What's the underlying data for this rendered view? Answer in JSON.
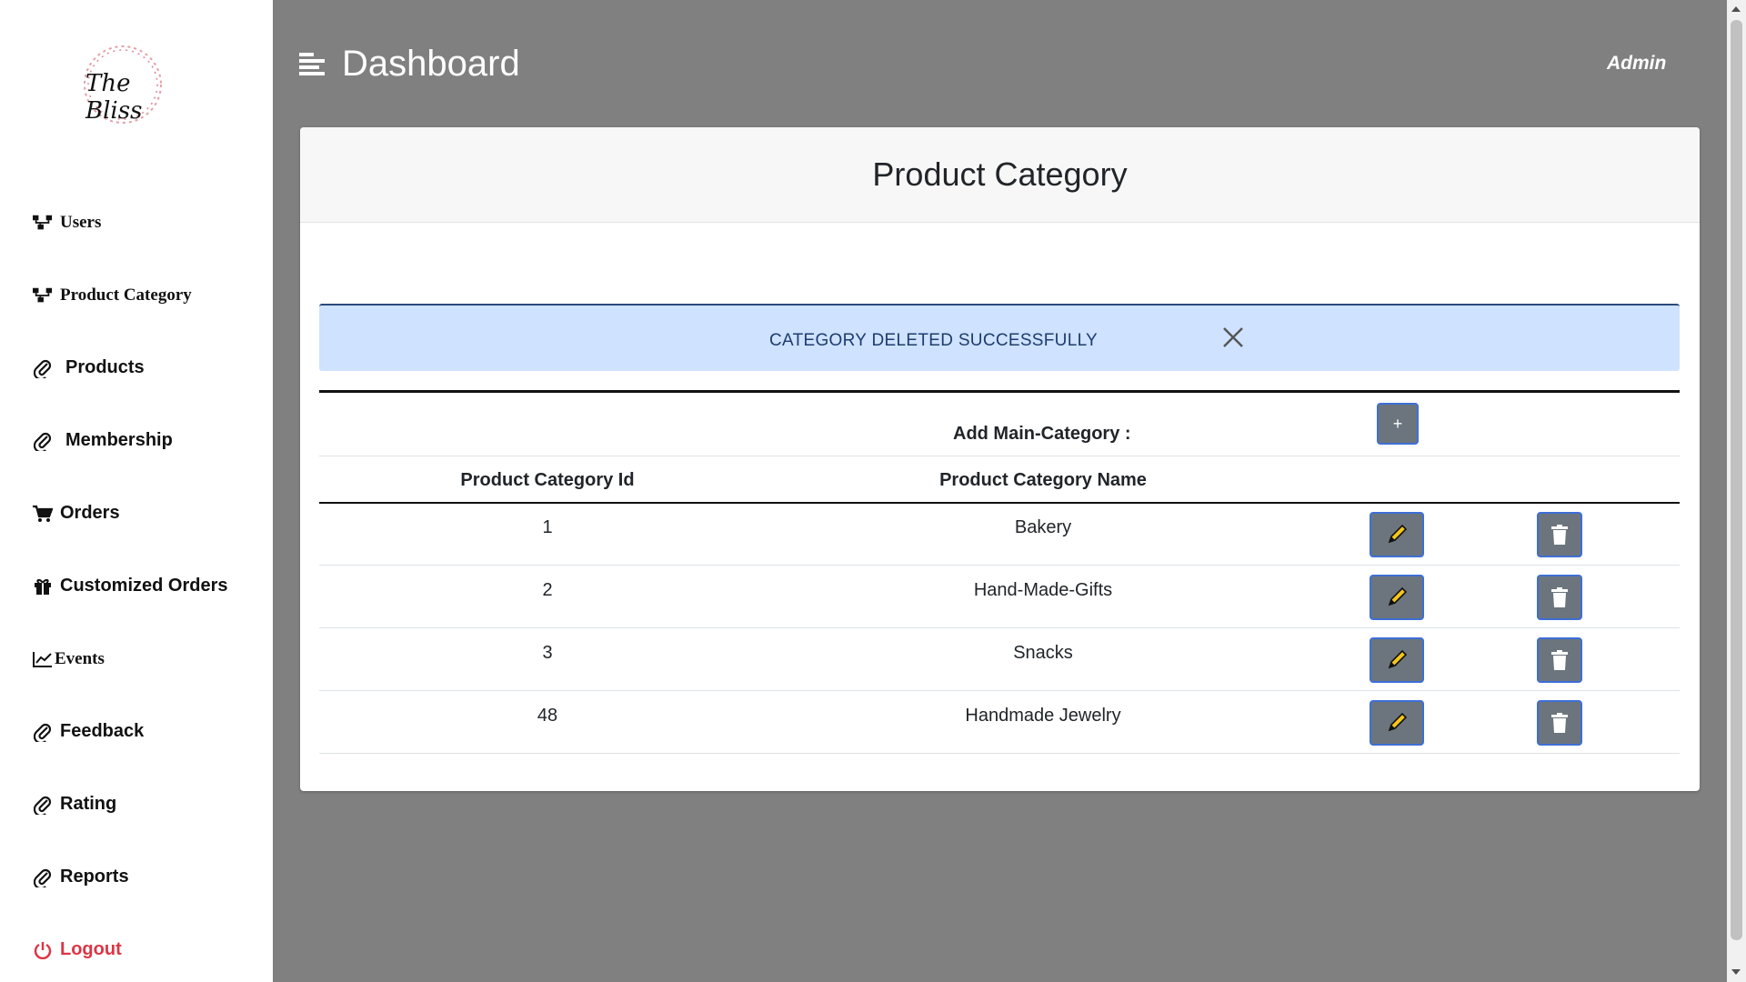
{
  "sidebar": {
    "logo_text": "The Bliss",
    "items": [
      {
        "label": "Users",
        "icon": "sitemap-icon"
      },
      {
        "label": "Product Category",
        "icon": "sitemap-icon"
      },
      {
        "label": "Products",
        "icon": "paperclip-icon"
      },
      {
        "label": "Membership",
        "icon": "paperclip-icon"
      },
      {
        "label": "Orders",
        "icon": "cart-icon"
      },
      {
        "label": "Customized Orders",
        "icon": "gift-icon"
      },
      {
        "label": "Events",
        "icon": "line-chart-icon"
      },
      {
        "label": "Feedback",
        "icon": "paperclip-icon"
      },
      {
        "label": "Rating",
        "icon": "paperclip-icon"
      },
      {
        "label": "Reports",
        "icon": "paperclip-icon"
      },
      {
        "label": "Logout",
        "icon": "power-icon"
      }
    ]
  },
  "header": {
    "title": "Dashboard",
    "user": "Admin"
  },
  "card": {
    "title": "Product Category",
    "alert": "CATEGORY DELETED SUCCESSFULLY",
    "add_label": "Add Main-Category :",
    "add_button": "+",
    "columns": [
      "Product Category Id",
      "Product Category Name"
    ],
    "rows": [
      {
        "id": "1",
        "name": "Bakery"
      },
      {
        "id": "2",
        "name": "Hand-Made-Gifts"
      },
      {
        "id": "3",
        "name": "Snacks"
      },
      {
        "id": "48",
        "name": "Handmade Jewelry"
      }
    ]
  },
  "colors": {
    "sidebar_bg": "#ffffff",
    "main_bg": "#808080",
    "alert_bg": "#cfe2ff",
    "button_bg": "#6c757d",
    "logout": "#dc3545",
    "pencil": "#f5c518"
  }
}
